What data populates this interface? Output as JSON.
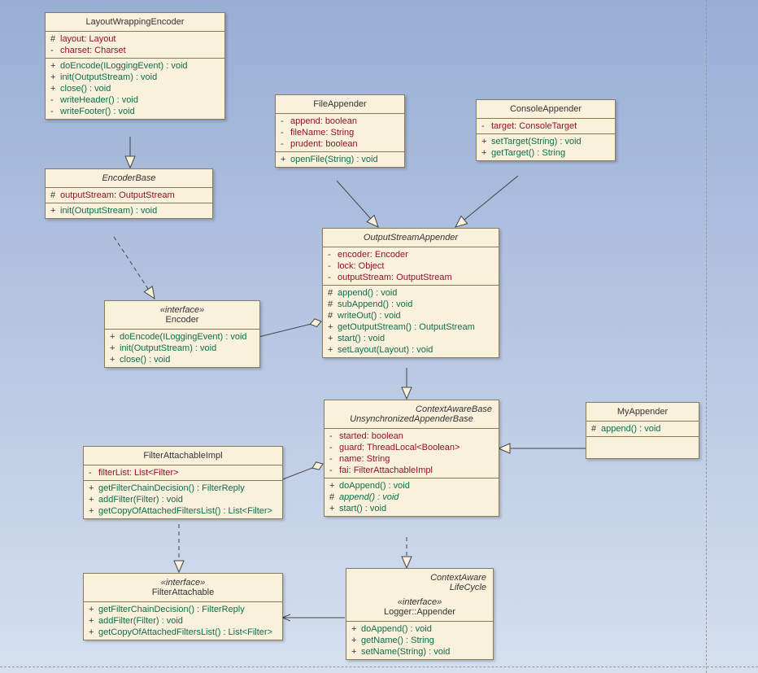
{
  "c1": {
    "name": "LayoutWrappingEncoder",
    "a": [
      {
        "v": "#",
        "s": "layout: Layout"
      },
      {
        "v": "-",
        "s": "charset: Charset"
      }
    ],
    "o": [
      {
        "v": "+",
        "s": "doEncode(ILoggingEvent) : void"
      },
      {
        "v": "+",
        "s": "init(OutputStream) : void"
      },
      {
        "v": "+",
        "s": "close() : void"
      },
      {
        "v": "-",
        "s": "writeHeader() : void"
      },
      {
        "v": "-",
        "s": "writeFooter() : void"
      }
    ]
  },
  "c2": {
    "name": "EncoderBase",
    "a": [
      {
        "v": "#",
        "s": "outputStream: OutputStream"
      }
    ],
    "o": [
      {
        "v": "+",
        "s": "init(OutputStream) : void"
      }
    ]
  },
  "c3": {
    "stereo": "«interface»",
    "name": "Encoder",
    "o": [
      {
        "v": "+",
        "s": "doEncode(ILoggingEvent) : void"
      },
      {
        "v": "+",
        "s": "init(OutputStream) : void"
      },
      {
        "v": "+",
        "s": "close() : void"
      }
    ]
  },
  "c4": {
    "name": "FileAppender",
    "a": [
      {
        "v": "-",
        "s": "append: boolean"
      },
      {
        "v": "-",
        "s": "fileName: String"
      },
      {
        "v": "-",
        "s": "prudent: boolean"
      }
    ],
    "o": [
      {
        "v": "+",
        "s": "openFile(String) : void"
      }
    ]
  },
  "c5": {
    "name": "ConsoleAppender",
    "a": [
      {
        "v": "-",
        "s": "target: ConsoleTarget"
      }
    ],
    "o": [
      {
        "v": "+",
        "s": "setTarget(String) : void"
      },
      {
        "v": "+",
        "s": "getTarget() : String"
      }
    ]
  },
  "c6": {
    "name": "OutputStreamAppender",
    "a": [
      {
        "v": "-",
        "s": "encoder: Encoder"
      },
      {
        "v": "-",
        "s": "lock: Object"
      },
      {
        "v": "-",
        "s": "outputStream: OutputStream"
      }
    ],
    "o": [
      {
        "v": "#",
        "s": "append() : void"
      },
      {
        "v": "#",
        "s": "subAppend() : void"
      },
      {
        "v": "#",
        "s": "writeOut() : void"
      },
      {
        "v": "+",
        "s": "getOutputStream() : OutputStream"
      },
      {
        "v": "+",
        "s": "start() : void"
      },
      {
        "v": "+",
        "s": "setLayout(Layout) : void"
      }
    ]
  },
  "c7": {
    "stereo": "ContextAwareBase",
    "name": "UnsynchronizedAppenderBase",
    "a": [
      {
        "v": "-",
        "s": "started: boolean"
      },
      {
        "v": "-",
        "s": "guard: ThreadLocal<Boolean>"
      },
      {
        "v": "-",
        "s": "name: String"
      },
      {
        "v": "-",
        "s": "fai: FilterAttachableImpl"
      }
    ],
    "o": [
      {
        "v": "+",
        "s": "doAppend() : void"
      },
      {
        "v": "#",
        "s": "append() : void",
        "abs": true
      },
      {
        "v": "+",
        "s": "start() : void"
      }
    ]
  },
  "c8": {
    "name": "MyAppender",
    "o": [
      {
        "v": "#",
        "s": "append() : void"
      }
    ]
  },
  "c9": {
    "name": "FilterAttachableImpl",
    "a": [
      {
        "v": "-",
        "s": "filterList: List<Filter>"
      }
    ],
    "o": [
      {
        "v": "+",
        "s": "getFilterChainDecision() : FilterReply"
      },
      {
        "v": "+",
        "s": "addFilter(Filter) : void"
      },
      {
        "v": "+",
        "s": "getCopyOfAttachedFiltersList() : List<Filter>"
      }
    ]
  },
  "c10": {
    "stereo": "«interface»",
    "name": "FilterAttachable",
    "o": [
      {
        "v": "+",
        "s": "getFilterChainDecision() : FilterReply"
      },
      {
        "v": "+",
        "s": "addFilter(Filter) : void"
      },
      {
        "v": "+",
        "s": "getCopyOfAttachedFiltersList() : List<Filter>"
      }
    ]
  },
  "c11": {
    "stereo": "ContextAware",
    "stereo2": "LifeCycle",
    "stereo3": "«interface»",
    "name": "Logger::Appender",
    "o": [
      {
        "v": "+",
        "s": "doAppend() : void"
      },
      {
        "v": "+",
        "s": "getName() : String"
      },
      {
        "v": "+",
        "s": "setName(String) : void"
      }
    ]
  }
}
